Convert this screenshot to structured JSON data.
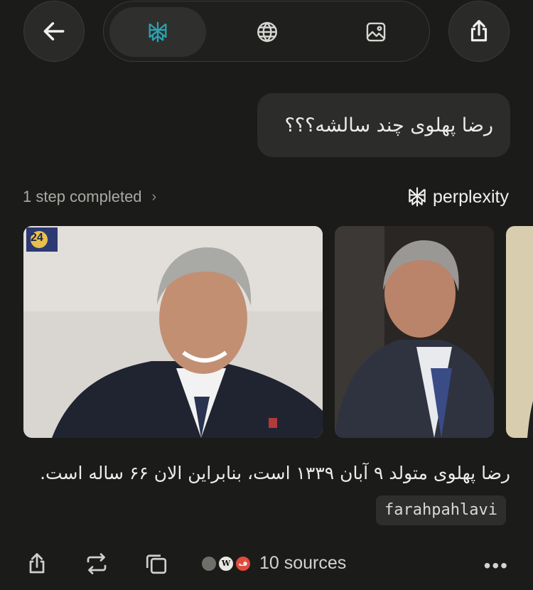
{
  "header": {
    "back_icon": "arrow-left-icon",
    "tabs": [
      {
        "icon": "perplexity-logo-icon",
        "active": true
      },
      {
        "icon": "globe-icon",
        "active": false
      },
      {
        "icon": "image-icon",
        "active": false
      }
    ],
    "share_icon": "share-icon"
  },
  "query": "رضا پهلوی چند سالشه؟؟؟",
  "steps": {
    "label": "1 step completed"
  },
  "brand": {
    "name": "perplexity"
  },
  "images": {
    "badge": "24"
  },
  "answer": {
    "text": "رضا پهلوی متولد ۹ آبان ۱۳۳۹ است، بنابراین الان ۶۶ ساله است.",
    "citation": "farahpahlavi"
  },
  "footer": {
    "sources_label": "10 sources",
    "favicons": [
      "",
      "W",
      "ف"
    ]
  },
  "colors": {
    "accent": "#29a3b0",
    "background": "#1b1b1a"
  }
}
